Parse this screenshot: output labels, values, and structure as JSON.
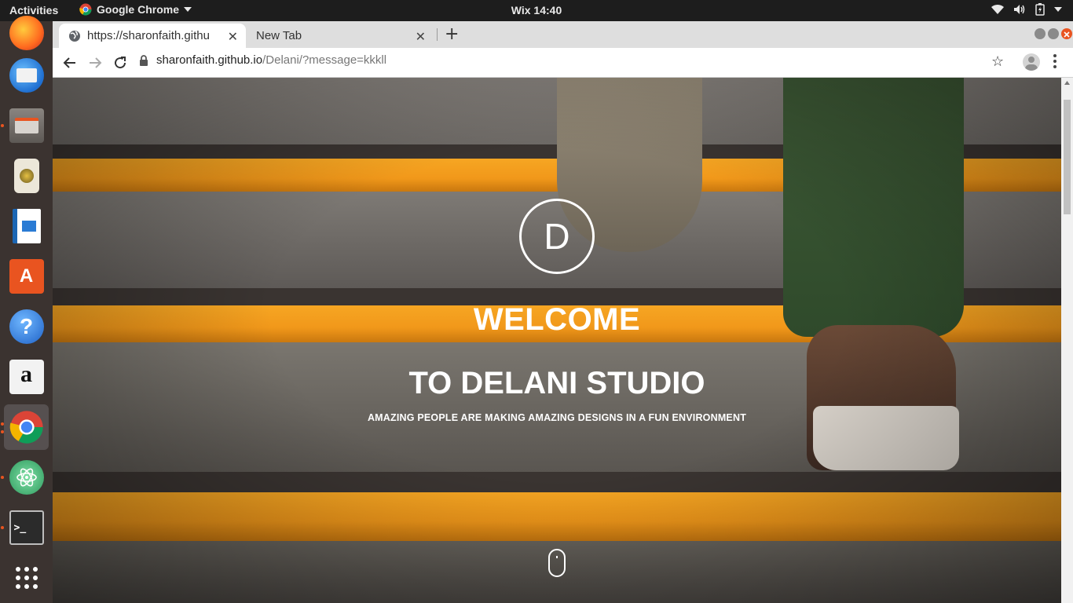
{
  "topbar": {
    "activities": "Activities",
    "app_name": "Google Chrome",
    "clock": "Wix 14:40",
    "tray_icons": [
      "wifi-icon",
      "volume-icon",
      "battery-icon",
      "system-menu-icon"
    ]
  },
  "dock": {
    "items": [
      {
        "name": "firefox",
        "running": false
      },
      {
        "name": "thunderbird",
        "running": false
      },
      {
        "name": "files",
        "running": true
      },
      {
        "name": "rhythmbox",
        "running": false
      },
      {
        "name": "libreoffice-writer",
        "running": false
      },
      {
        "name": "ubuntu-software",
        "running": false
      },
      {
        "name": "help",
        "running": false
      },
      {
        "name": "amazon",
        "running": false
      },
      {
        "name": "chrome",
        "running": true,
        "active": true
      },
      {
        "name": "atom",
        "running": true
      },
      {
        "name": "terminal",
        "running": true
      },
      {
        "name": "show-applications",
        "running": false
      }
    ],
    "amazon_glyph": "a",
    "help_glyph": "?",
    "terminal_glyph": ">_"
  },
  "browser": {
    "tabs": [
      {
        "title": "https://sharonfaith.githu",
        "active": true
      },
      {
        "title": "New Tab",
        "active": false
      }
    ],
    "new_tab_glyph": "+",
    "url_host": "sharonfaith.github.io",
    "url_path": "/Delani/?message=kkkll"
  },
  "hero": {
    "logo_letter": "D",
    "welcome": "WELCOME",
    "studio": "TO DELANI STUDIO",
    "tagline": "AMAZING PEOPLE ARE MAKING AMAZING DESIGNS IN A FUN ENVIRONMENT"
  },
  "colors": {
    "stripe": "#f6a623",
    "step_gray": "#6b6a67",
    "dock_bg": "#3b3330",
    "topbar_bg": "#1d1d1d",
    "ubuntu_orange": "#e95420"
  }
}
